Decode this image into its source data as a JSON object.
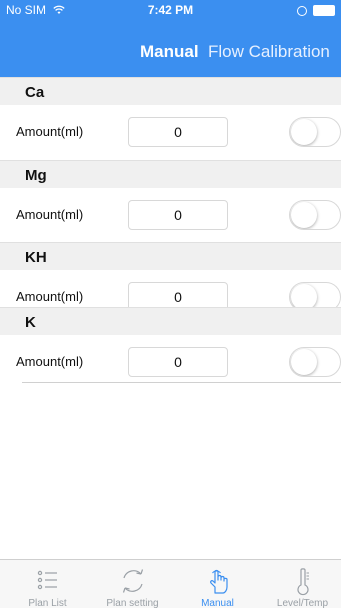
{
  "status": {
    "carrier": "No SIM",
    "time": "7:42 PM"
  },
  "nav": {
    "active_tab": "Manual",
    "other_tab": "Flow Calibration"
  },
  "sections": [
    {
      "title": "Ca",
      "row": {
        "label": "Amount(ml)",
        "value": "0",
        "enabled": false
      }
    },
    {
      "title": "Mg",
      "row": {
        "label": "Amount(ml)",
        "value": "0",
        "enabled": false
      }
    },
    {
      "title": "KH",
      "row": {
        "label": "Amount(ml)",
        "value": "0",
        "enabled": false
      }
    },
    {
      "title": "K",
      "row": {
        "label": "Amount(ml)",
        "value": "0",
        "enabled": false
      }
    }
  ],
  "tabbar": {
    "items": [
      {
        "label": "Plan List",
        "icon": "list-icon",
        "active": false
      },
      {
        "label": "Plan setting",
        "icon": "refresh-icon",
        "active": false
      },
      {
        "label": "Manual",
        "icon": "hand-pointer-icon",
        "active": true
      },
      {
        "label": "Level/Temp",
        "icon": "thermometer-icon",
        "active": false
      }
    ]
  },
  "colors": {
    "header": "#3b8ff0",
    "active_tab": "#3b8ff0",
    "inactive_tab": "#9aa0a6",
    "section_bg": "#f0f0f0"
  }
}
